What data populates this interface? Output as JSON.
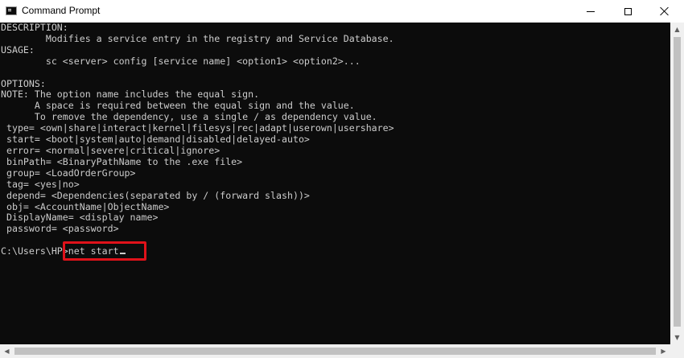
{
  "window": {
    "title": "Command Prompt",
    "icon": "cmd-icon",
    "controls": {
      "minimize": "minimize-icon",
      "maximize": "maximize-icon",
      "close": "close-icon"
    }
  },
  "console": {
    "lines": [
      "DESCRIPTION:",
      "        Modifies a service entry in the registry and Service Database.",
      "USAGE:",
      "        sc <server> config [service name] <option1> <option2>...",
      "",
      "OPTIONS:",
      "NOTE: The option name includes the equal sign.",
      "      A space is required between the equal sign and the value.",
      "      To remove the dependency, use a single / as dependency value.",
      " type= <own|share|interact|kernel|filesys|rec|adapt|userown|usershare>",
      " start= <boot|system|auto|demand|disabled|delayed-auto>",
      " error= <normal|severe|critical|ignore>",
      " binPath= <BinaryPathName to the .exe file>",
      " group= <LoadOrderGroup>",
      " tag= <yes|no>",
      " depend= <Dependencies(separated by / (forward slash))>",
      " obj= <AccountName|ObjectName>",
      " DisplayName= <display name>",
      " password= <password>",
      ""
    ],
    "prompt": "C:\\Users\\HP>",
    "command": "net start",
    "colors": {
      "background": "#0c0c0c",
      "foreground": "#cccccc",
      "highlight_box": "#e0121a"
    }
  }
}
